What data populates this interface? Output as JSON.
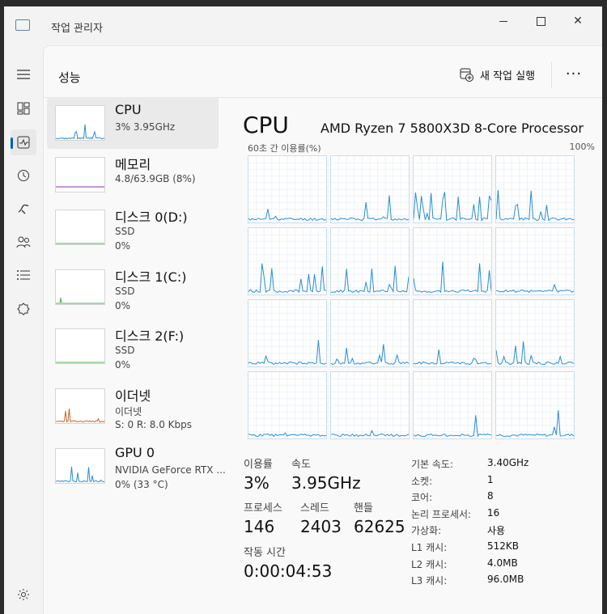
{
  "window": {
    "title": "작업 관리자"
  },
  "header": {
    "title": "성능",
    "run_task_label": "새 작업 실행",
    "more_label": "···"
  },
  "devices": [
    {
      "name": "CPU",
      "line1": "3% 3.95GHz",
      "line2": "",
      "color": "#2a8dd4"
    },
    {
      "name": "메모리",
      "line1": "4.8/63.9GB (8%)",
      "line2": "",
      "color": "#8b2da5"
    },
    {
      "name": "디스크 0(D:)",
      "line1": "SSD",
      "line2": "0%",
      "color": "#4caf50"
    },
    {
      "name": "디스크 1(C:)",
      "line1": "SSD",
      "line2": "0%",
      "color": "#4caf50"
    },
    {
      "name": "디스크 2(F:)",
      "line1": "SSD",
      "line2": "0%",
      "color": "#4caf50"
    },
    {
      "name": "이더넷",
      "line1": "이더넷",
      "line2": "S: 0 R: 8.0 Kbps",
      "color": "#c8642a"
    },
    {
      "name": "GPU 0",
      "line1": "NVIDIA GeForce RTX ...",
      "line2": "0% (33 °C)",
      "color": "#2a8dd4"
    }
  ],
  "cpu": {
    "title": "CPU",
    "model": "AMD Ryzen 7 5800X3D 8-Core Processor",
    "graph_label": "60초 간 이용률(%)",
    "graph_max": "100%",
    "core_count": 16,
    "stats": {
      "utilization_label": "이용률",
      "utilization": "3%",
      "speed_label": "속도",
      "speed": "3.95GHz",
      "processes_label": "프로세스",
      "processes": "146",
      "threads_label": "스레드",
      "threads": "2403",
      "handles_label": "핸들",
      "handles": "62625",
      "uptime_label": "작동 시간",
      "uptime": "0:00:04:53"
    },
    "info": [
      {
        "label": "기본 속도:",
        "value": "3.40GHz"
      },
      {
        "label": "소켓:",
        "value": "1"
      },
      {
        "label": "코어:",
        "value": "8"
      },
      {
        "label": "논리 프로세서:",
        "value": "16"
      },
      {
        "label": "가상화:",
        "value": "사용"
      },
      {
        "label": "L1 캐시:",
        "value": "512KB"
      },
      {
        "label": "L2 캐시:",
        "value": "4.0MB"
      },
      {
        "label": "L3 캐시:",
        "value": "96.0MB"
      }
    ]
  }
}
